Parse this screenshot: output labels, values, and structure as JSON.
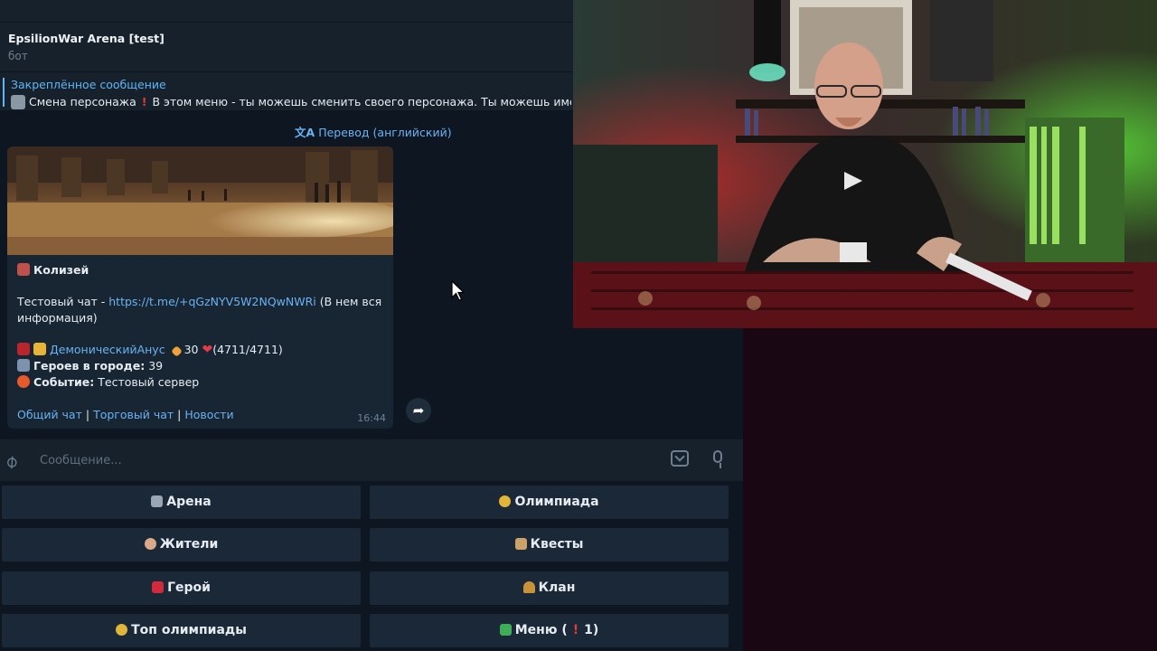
{
  "chat": {
    "title": "EpsilionWar Arena [test]",
    "subtitle": "бот"
  },
  "pinned": {
    "title": "Закреплённое сообщение",
    "item": "Смена персонажа",
    "text": "В этом меню - ты можешь сменить своего персонажа. Ты можешь иметь"
  },
  "translate": {
    "label": "Перевод (английский)",
    "icon": "translate-icon"
  },
  "message": {
    "header": "Колизей",
    "test_chat_label": "Тестовый чат - ",
    "test_chat_link": "https://t.me/+qGzNYV5W2NQwNWRi",
    "test_chat_suffix": " (В нем вся",
    "test_chat_suffix2": "информация)",
    "player_name": "ДемоническийАнус",
    "player_level": "30",
    "player_hp": "(4711/4711)",
    "heroes_label": "Героев в городе:",
    "heroes_count": "39",
    "event_label": "Событие:",
    "event_value": "Тестовый сервер",
    "footer_link1": "Общий чат",
    "footer_sep": "|",
    "footer_link2": "Торговый чат",
    "footer_link3": "Новости",
    "time": "16:44"
  },
  "composer": {
    "placeholder": "Сообщение..."
  },
  "keyboard": {
    "buttons": [
      {
        "label": "Арена",
        "icon": "crossed-swords-icon"
      },
      {
        "label": "Олимпиада",
        "icon": "medal-icon"
      },
      {
        "label": "Жители",
        "icon": "person-icon"
      },
      {
        "label": "Квесты",
        "icon": "scroll-icon"
      },
      {
        "label": "Герой",
        "icon": "flag-icon"
      },
      {
        "label": "Клан",
        "icon": "shield-icon"
      },
      {
        "label": "Топ олимпиады",
        "icon": "medal-icon"
      },
      {
        "label": "Меню (",
        "icon": "money-icon",
        "badge": "1)"
      }
    ]
  },
  "colors": {
    "accent": "#6ab2f2",
    "panel": "#17212b",
    "background": "#0e1621",
    "bubble": "#182533"
  }
}
